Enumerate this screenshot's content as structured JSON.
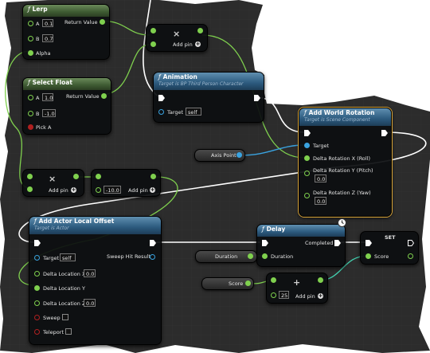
{
  "nodes": {
    "lerp": {
      "title": "Lerp",
      "a_label": "A",
      "a_value": "0.1",
      "b_label": "B",
      "b_value": "0.7",
      "alpha_label": "Alpha",
      "return_label": "Return Value"
    },
    "select_float": {
      "title": "Select Float",
      "a_label": "A",
      "a_value": "1.0",
      "b_label": "B",
      "b_value": "-1.0",
      "pick_label": "Pick A",
      "return_label": "Return Value"
    },
    "multiply_top": {
      "symbol": "×",
      "add_pin_label": "Add pin"
    },
    "animation": {
      "title": "Animation",
      "subtitle": "Target is BP Third Person Character",
      "target_label": "Target",
      "target_value": "self"
    },
    "add_world_rotation": {
      "title": "Add World Rotation",
      "subtitle": "Target is Scene Component",
      "target_label": "Target",
      "roll_label": "Delta Rotation X (Roll)",
      "pitch_label": "Delta Rotation Y (Pitch)",
      "pitch_value": "0.0",
      "yaw_label": "Delta Rotation Z (Yaw)",
      "yaw_value": "0.0"
    },
    "axis_point": {
      "label": "Axis Point"
    },
    "multiply_left": {
      "symbol": "×",
      "add_pin_label": "Add pin"
    },
    "multiply_mid": {
      "value": "-10.0",
      "add_pin_label": "Add pin"
    },
    "add_actor_local_offset": {
      "title": "Add Actor Local Offset",
      "subtitle": "Target is Actor",
      "target_label": "Target",
      "target_value": "self",
      "sweep_hit_label": "Sweep Hit Result",
      "dx_label": "Delta Location X",
      "dx_value": "0.0",
      "dy_label": "Delta Location Y",
      "dz_label": "Delta Location Z",
      "dz_value": "0.0",
      "sweep_label": "Sweep",
      "teleport_label": "Teleport"
    },
    "delay": {
      "title": "Delay",
      "completed_label": "Completed",
      "duration_label": "Duration"
    },
    "duration_var": {
      "label": "Duration"
    },
    "set_score": {
      "title": "SET",
      "score_label": "Score"
    },
    "score_var": {
      "label": "Score"
    },
    "add_node": {
      "symbol": "+",
      "value": "25",
      "add_pin_label": "Add pin"
    }
  },
  "colors": {
    "exec_wire": "#ffffff",
    "float_wire": "#7fd04e",
    "object_wire": "#3aa3e0",
    "header_function": "#2c5a7e",
    "header_pure": "#3e5a32",
    "canvas": "#2a2a2a"
  }
}
